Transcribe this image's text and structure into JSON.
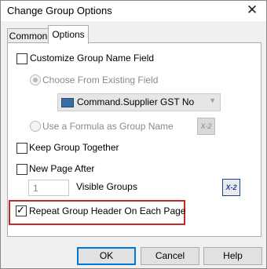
{
  "dialog": {
    "title": "Change Group Options",
    "close_icon": "close-icon"
  },
  "tabs": [
    {
      "label": "Common",
      "active": false
    },
    {
      "label": "Options",
      "active": true
    }
  ],
  "options": {
    "customize_group_name": {
      "label": "Customize Group Name Field",
      "checked": false
    },
    "choose_existing": {
      "label": "Choose From Existing Field",
      "selected": true,
      "enabled": false
    },
    "field_select": {
      "value": "Command.Supplier GST No",
      "icon": "database-field-icon",
      "enabled": false
    },
    "use_formula": {
      "label": "Use a Formula as Group Name",
      "selected": false,
      "enabled": false,
      "button_label": "X-2"
    },
    "keep_together": {
      "label": "Keep Group Together",
      "checked": false
    },
    "new_page_after": {
      "label": "New Page After",
      "checked": false,
      "count": "1",
      "suffix": "Visible Groups",
      "button_label": "X-2"
    },
    "repeat_header": {
      "label": "Repeat Group Header On Each Page",
      "checked": true
    }
  },
  "buttons": {
    "ok": "OK",
    "cancel": "Cancel",
    "help": "Help"
  },
  "colors": {
    "highlight": "#c62828",
    "focus": "#0078d7"
  }
}
